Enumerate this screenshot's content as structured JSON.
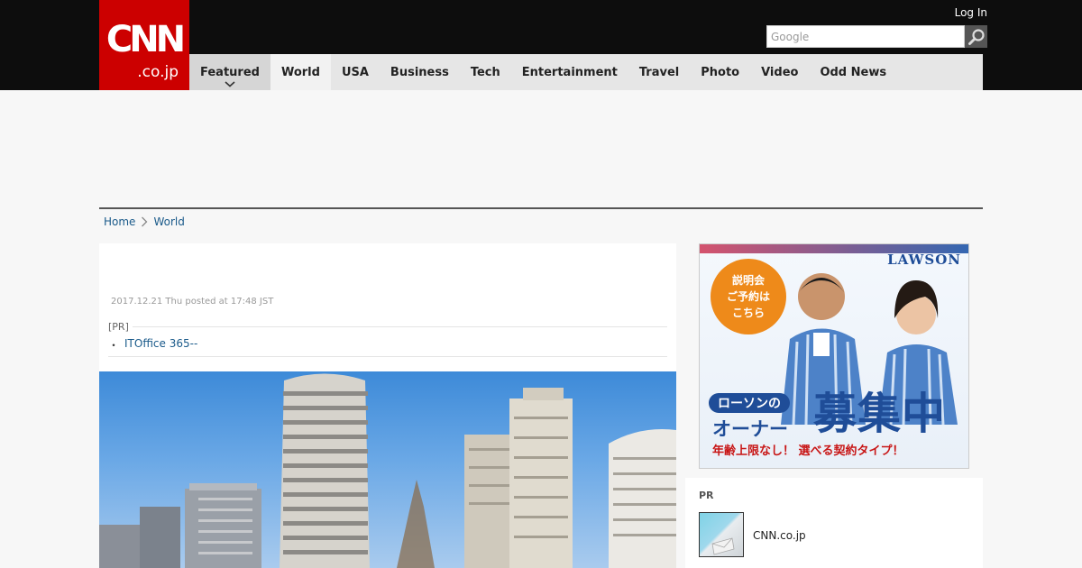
{
  "header": {
    "logo_text_main": "CNN",
    "logo_text_domain": ".co.jp",
    "login_label": "Log In",
    "search": {
      "placeholder": "Google"
    }
  },
  "nav": {
    "items": [
      {
        "label": "Featured"
      },
      {
        "label": "World"
      },
      {
        "label": "USA"
      },
      {
        "label": "Business"
      },
      {
        "label": "Tech"
      },
      {
        "label": "Entertainment"
      },
      {
        "label": "Travel"
      },
      {
        "label": "Photo"
      },
      {
        "label": "Video"
      },
      {
        "label": "Odd News"
      }
    ],
    "active_index": 1
  },
  "breadcrumb": {
    "home": "Home",
    "current": "World"
  },
  "article": {
    "date": "2017.12.21 Thu posted at 17:48 JST",
    "pr_label": "[PR]",
    "pr_bullet": "・",
    "pr_link": "ITOffice 365--"
  },
  "sidebar_ad": {
    "logo": "LAWSON",
    "circle_lines": [
      "説明会",
      "ご予約は",
      "こちら"
    ],
    "pill": "ローソンの",
    "owner": "オーナー",
    "recruit": "募集中",
    "bottom": "年齢上限なし！ 選べる契約タイプ！"
  },
  "pr_card": {
    "label": "PR",
    "title": "CNN.co.jp"
  },
  "colors": {
    "brand_red": "#cc0000",
    "topbar": "#0d0d0d",
    "nav_bg": "#e6e6e6",
    "link": "#1a5a8a",
    "lawson_blue": "#1f4d98",
    "ad_orange": "#ee8a1a"
  }
}
